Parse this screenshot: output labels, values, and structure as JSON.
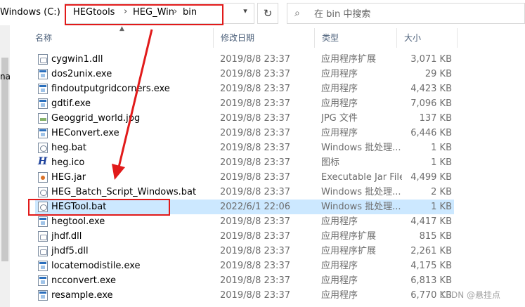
{
  "address": {
    "drive": "Windows (C:)",
    "crumbs": [
      "HEGtools",
      "HEG_Win",
      "bin"
    ],
    "separator": "›",
    "dropdown_icon": "chevron-down-icon",
    "refresh_icon": "refresh-icon"
  },
  "search": {
    "placeholder": "在 bin 中搜索",
    "icon": "search-icon"
  },
  "navpane": {
    "partial_text": "na"
  },
  "columns": {
    "name": "名称",
    "date": "修改日期",
    "type": "类型",
    "size": "大小"
  },
  "files": [
    {
      "name": "cygwin1.dll",
      "date": "2019/8/8 23:37",
      "type": "应用程序扩展",
      "size": "3,071 KB",
      "icon": "dll"
    },
    {
      "name": "dos2unix.exe",
      "date": "2019/8/8 23:37",
      "type": "应用程序",
      "size": "29 KB",
      "icon": "exe"
    },
    {
      "name": "findoutputgridcorners.exe",
      "date": "2019/8/8 23:37",
      "type": "应用程序",
      "size": "4,423 KB",
      "icon": "exe"
    },
    {
      "name": "gdtif.exe",
      "date": "2019/8/8 23:37",
      "type": "应用程序",
      "size": "7,096 KB",
      "icon": "exe"
    },
    {
      "name": "Geoggrid_world.jpg",
      "date": "2019/8/8 23:37",
      "type": "JPG 文件",
      "size": "137 KB",
      "icon": "jpg"
    },
    {
      "name": "HEConvert.exe",
      "date": "2019/8/8 23:37",
      "type": "应用程序",
      "size": "6,446 KB",
      "icon": "exe"
    },
    {
      "name": "heg.bat",
      "date": "2019/8/8 23:37",
      "type": "Windows 批处理...",
      "size": "1 KB",
      "icon": "bat"
    },
    {
      "name": "heg.ico",
      "date": "2019/8/8 23:37",
      "type": "图标",
      "size": "1 KB",
      "icon": "ico"
    },
    {
      "name": "HEG.jar",
      "date": "2019/8/8 23:37",
      "type": "Executable Jar File",
      "size": "4,499 KB",
      "icon": "jar"
    },
    {
      "name": "HEG_Batch_Script_Windows.bat",
      "date": "2019/8/8 23:37",
      "type": "Windows 批处理...",
      "size": "2 KB",
      "icon": "bat"
    },
    {
      "name": "HEGTool.bat",
      "date": "2022/6/1 22:06",
      "type": "Windows 批处理...",
      "size": "1 KB",
      "icon": "bat",
      "selected": true
    },
    {
      "name": "hegtool.exe",
      "date": "2019/8/8 23:37",
      "type": "应用程序",
      "size": "4,417 KB",
      "icon": "exe"
    },
    {
      "name": "jhdf.dll",
      "date": "2019/8/8 23:37",
      "type": "应用程序扩展",
      "size": "815 KB",
      "icon": "dll"
    },
    {
      "name": "jhdf5.dll",
      "date": "2019/8/8 23:37",
      "type": "应用程序扩展",
      "size": "2,261 KB",
      "icon": "dll"
    },
    {
      "name": "locatemodistile.exe",
      "date": "2019/8/8 23:37",
      "type": "应用程序",
      "size": "4,175 KB",
      "icon": "exe"
    },
    {
      "name": "ncconvert.exe",
      "date": "2019/8/8 23:37",
      "type": "应用程序",
      "size": "6,813 KB",
      "icon": "exe"
    },
    {
      "name": "resample.exe",
      "date": "2019/8/8 23:37",
      "type": "应用程序",
      "size": "6,770 KB",
      "icon": "exe"
    }
  ],
  "watermark": "CSDN @悬挂点",
  "colors": {
    "annotation": "#e11a1a",
    "selection": "#cce8ff"
  }
}
